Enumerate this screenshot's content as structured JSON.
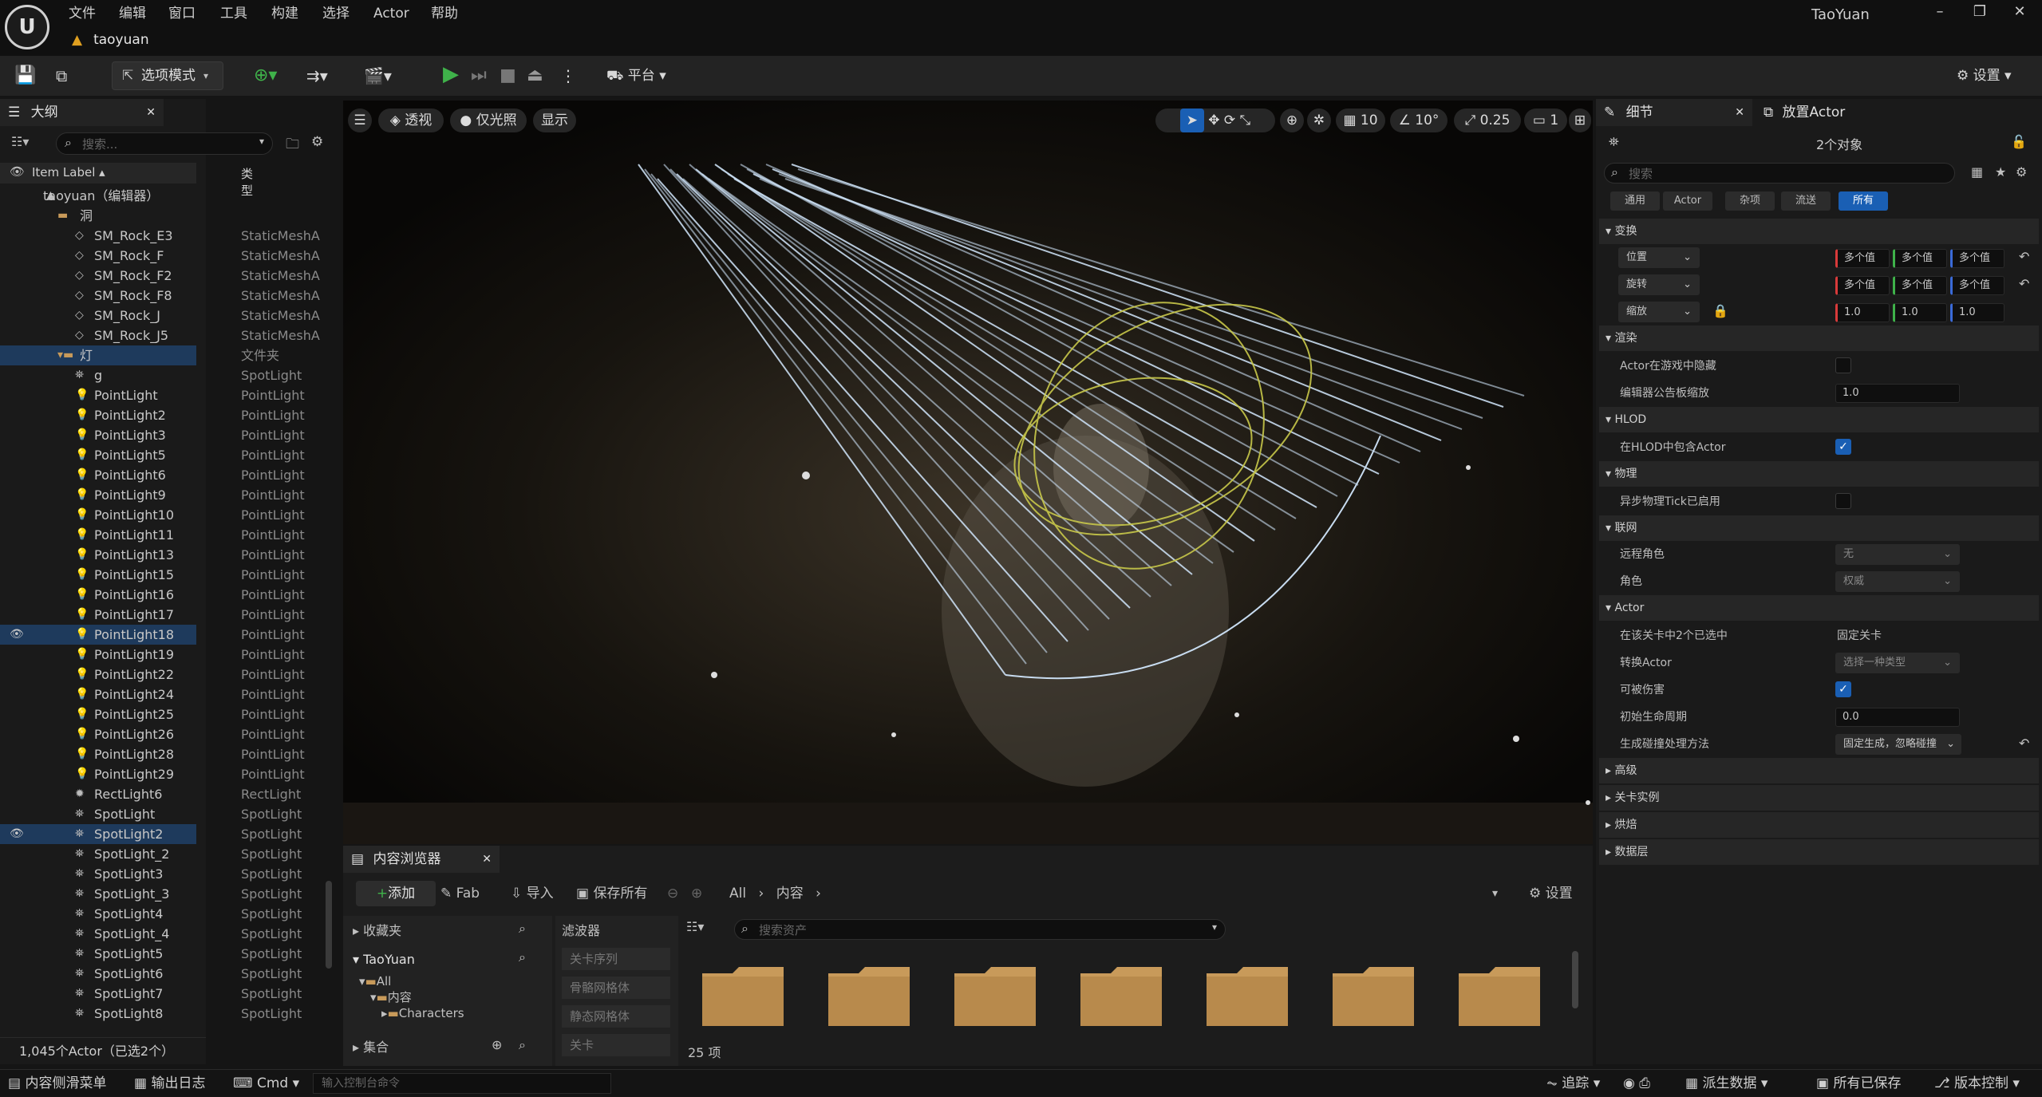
{
  "app": {
    "logo": "U",
    "user": "TaoYuan",
    "project_tab": "taoyuan"
  },
  "menu": [
    "文件",
    "编辑",
    "窗口",
    "工具",
    "构建",
    "选择",
    "Actor",
    "帮助"
  ],
  "toolbar": {
    "mode": "选项模式",
    "platform": "平台",
    "settings": "设置"
  },
  "outliner": {
    "tab": "大纲",
    "search_placeholder": "搜索...",
    "col_label": "Item Label ▴",
    "col_type": "类型",
    "rows": [
      {
        "name": "taoyuan（编辑器）",
        "type": "",
        "indent": 0,
        "icon": "level"
      },
      {
        "name": "洞",
        "type": "",
        "indent": 1,
        "icon": "folder"
      },
      {
        "name": "SM_Rock_E3",
        "type": "StaticMeshA",
        "indent": 2,
        "icon": "mesh"
      },
      {
        "name": "SM_Rock_F",
        "type": "StaticMeshA",
        "indent": 2,
        "icon": "mesh"
      },
      {
        "name": "SM_Rock_F2",
        "type": "StaticMeshA",
        "indent": 2,
        "icon": "mesh"
      },
      {
        "name": "SM_Rock_F8",
        "type": "StaticMeshA",
        "indent": 2,
        "icon": "mesh"
      },
      {
        "name": "SM_Rock_J",
        "type": "StaticMeshA",
        "indent": 2,
        "icon": "mesh"
      },
      {
        "name": "SM_Rock_J5",
        "type": "StaticMeshA",
        "indent": 2,
        "icon": "mesh"
      },
      {
        "name": "灯",
        "type": "文件夹",
        "indent": 1,
        "icon": "folder",
        "selected": true
      },
      {
        "name": "g",
        "type": "SpotLight",
        "indent": 2,
        "icon": "spot"
      },
      {
        "name": "PointLight",
        "type": "PointLight",
        "indent": 2,
        "icon": "bulb"
      },
      {
        "name": "PointLight2",
        "type": "PointLight",
        "indent": 2,
        "icon": "bulb"
      },
      {
        "name": "PointLight3",
        "type": "PointLight",
        "indent": 2,
        "icon": "bulb"
      },
      {
        "name": "PointLight5",
        "type": "PointLight",
        "indent": 2,
        "icon": "bulb"
      },
      {
        "name": "PointLight6",
        "type": "PointLight",
        "indent": 2,
        "icon": "bulb"
      },
      {
        "name": "PointLight9",
        "type": "PointLight",
        "indent": 2,
        "icon": "bulb"
      },
      {
        "name": "PointLight10",
        "type": "PointLight",
        "indent": 2,
        "icon": "bulb"
      },
      {
        "name": "PointLight11",
        "type": "PointLight",
        "indent": 2,
        "icon": "bulb"
      },
      {
        "name": "PointLight13",
        "type": "PointLight",
        "indent": 2,
        "icon": "bulb"
      },
      {
        "name": "PointLight15",
        "type": "PointLight",
        "indent": 2,
        "icon": "bulb"
      },
      {
        "name": "PointLight16",
        "type": "PointLight",
        "indent": 2,
        "icon": "bulb"
      },
      {
        "name": "PointLight17",
        "type": "PointLight",
        "indent": 2,
        "icon": "bulb"
      },
      {
        "name": "PointLight18",
        "type": "PointLight",
        "indent": 2,
        "icon": "bulb",
        "selected": true,
        "eye": true
      },
      {
        "name": "PointLight19",
        "type": "PointLight",
        "indent": 2,
        "icon": "bulb"
      },
      {
        "name": "PointLight22",
        "type": "PointLight",
        "indent": 2,
        "icon": "bulb"
      },
      {
        "name": "PointLight24",
        "type": "PointLight",
        "indent": 2,
        "icon": "bulb"
      },
      {
        "name": "PointLight25",
        "type": "PointLight",
        "indent": 2,
        "icon": "bulb"
      },
      {
        "name": "PointLight26",
        "type": "PointLight",
        "indent": 2,
        "icon": "bulb"
      },
      {
        "name": "PointLight28",
        "type": "PointLight",
        "indent": 2,
        "icon": "bulb"
      },
      {
        "name": "PointLight29",
        "type": "PointLight",
        "indent": 2,
        "icon": "bulb"
      },
      {
        "name": "RectLight6",
        "type": "RectLight",
        "indent": 2,
        "icon": "rect"
      },
      {
        "name": "SpotLight",
        "type": "SpotLight",
        "indent": 2,
        "icon": "spot"
      },
      {
        "name": "SpotLight2",
        "type": "SpotLight",
        "indent": 2,
        "icon": "spot",
        "selected": true,
        "eye": true
      },
      {
        "name": "SpotLight_2",
        "type": "SpotLight",
        "indent": 2,
        "icon": "spot"
      },
      {
        "name": "SpotLight3",
        "type": "SpotLight",
        "indent": 2,
        "icon": "spot"
      },
      {
        "name": "SpotLight_3",
        "type": "SpotLight",
        "indent": 2,
        "icon": "spot"
      },
      {
        "name": "SpotLight4",
        "type": "SpotLight",
        "indent": 2,
        "icon": "spot"
      },
      {
        "name": "SpotLight_4",
        "type": "SpotLight",
        "indent": 2,
        "icon": "spot"
      },
      {
        "name": "SpotLight5",
        "type": "SpotLight",
        "indent": 2,
        "icon": "spot"
      },
      {
        "name": "SpotLight6",
        "type": "SpotLight",
        "indent": 2,
        "icon": "spot"
      },
      {
        "name": "SpotLight7",
        "type": "SpotLight",
        "indent": 2,
        "icon": "spot"
      },
      {
        "name": "SpotLight8",
        "type": "SpotLight",
        "indent": 2,
        "icon": "spot"
      }
    ],
    "footer": "1,045个Actor（已选2个）"
  },
  "viewport": {
    "perspective": "透视",
    "lighting": "仅光照",
    "show": "显示",
    "grid": "10",
    "angle": "10°",
    "scale": "0.25",
    "camera": "1"
  },
  "content_browser": {
    "tab": "内容浏览器",
    "add": "添加",
    "fab": "Fab",
    "import": "导入",
    "save_all": "保存所有",
    "path": [
      "All",
      "内容"
    ],
    "settings": "设置",
    "favorites": "收藏夹",
    "project": "TaoYuan",
    "tree": [
      "All",
      "内容",
      "Characters"
    ],
    "collections": "集合",
    "filters": "滤波器",
    "filter_items": [
      "关卡序列",
      "骨骼网格体",
      "静态网格体",
      "关卡"
    ],
    "search_placeholder": "搜索资产",
    "count": "25 项",
    "folders": 7
  },
  "details": {
    "tab": "细节",
    "tab2": "放置Actor",
    "selection": "2个对象",
    "search_placeholder": "搜索",
    "filters": [
      "通用",
      "Actor",
      "杂项",
      "流送",
      "所有"
    ],
    "sections": {
      "transform": "变换",
      "render": "渲染",
      "hlod": "HLOD",
      "physics": "物理",
      "network": "联网",
      "actor": "Actor",
      "advanced": "高级",
      "level_instance": "关卡实例",
      "cooking": "烘焙",
      "data_layers": "数据层"
    },
    "location": "位置",
    "rotation": "旋转",
    "scale": "缩放",
    "multi": "多个值",
    "scale_val": "1.0",
    "hidden_in_game": "Actor在游戏中隐藏",
    "billboard_scale": "编辑器公告板缩放",
    "billboard_val": "1.0",
    "include_hlod": "在HLOD中包含Actor",
    "async_physics": "异步物理Tick已启用",
    "remote_role": "远程角色",
    "remote_role_val": "无",
    "role": "角色",
    "role_val": "权威",
    "selected_in_level": "在该关卡中2个已选中",
    "selected_in_level_val": "固定关卡",
    "convert_actor": "转换Actor",
    "convert_actor_val": "选择一种类型",
    "can_be_damaged": "可被伤害",
    "initial_life": "初始生命周期",
    "initial_life_val": "0.0",
    "spawn_collision": "生成碰撞处理方法",
    "spawn_collision_val": "固定生成，忽略碰撞"
  },
  "status": {
    "drawer": "内容侧滑菜单",
    "output": "输出日志",
    "cmd": "Cmd",
    "cmd_placeholder": "输入控制台命令",
    "trace": "追踪",
    "derived": "派生数据",
    "saved": "所有已保存",
    "vcs": "版本控制"
  },
  "colors": {
    "accent": "#1a5fb4",
    "play": "#3fb24a",
    "selection": "#1e3a5c",
    "folder": "#c89a5a"
  }
}
